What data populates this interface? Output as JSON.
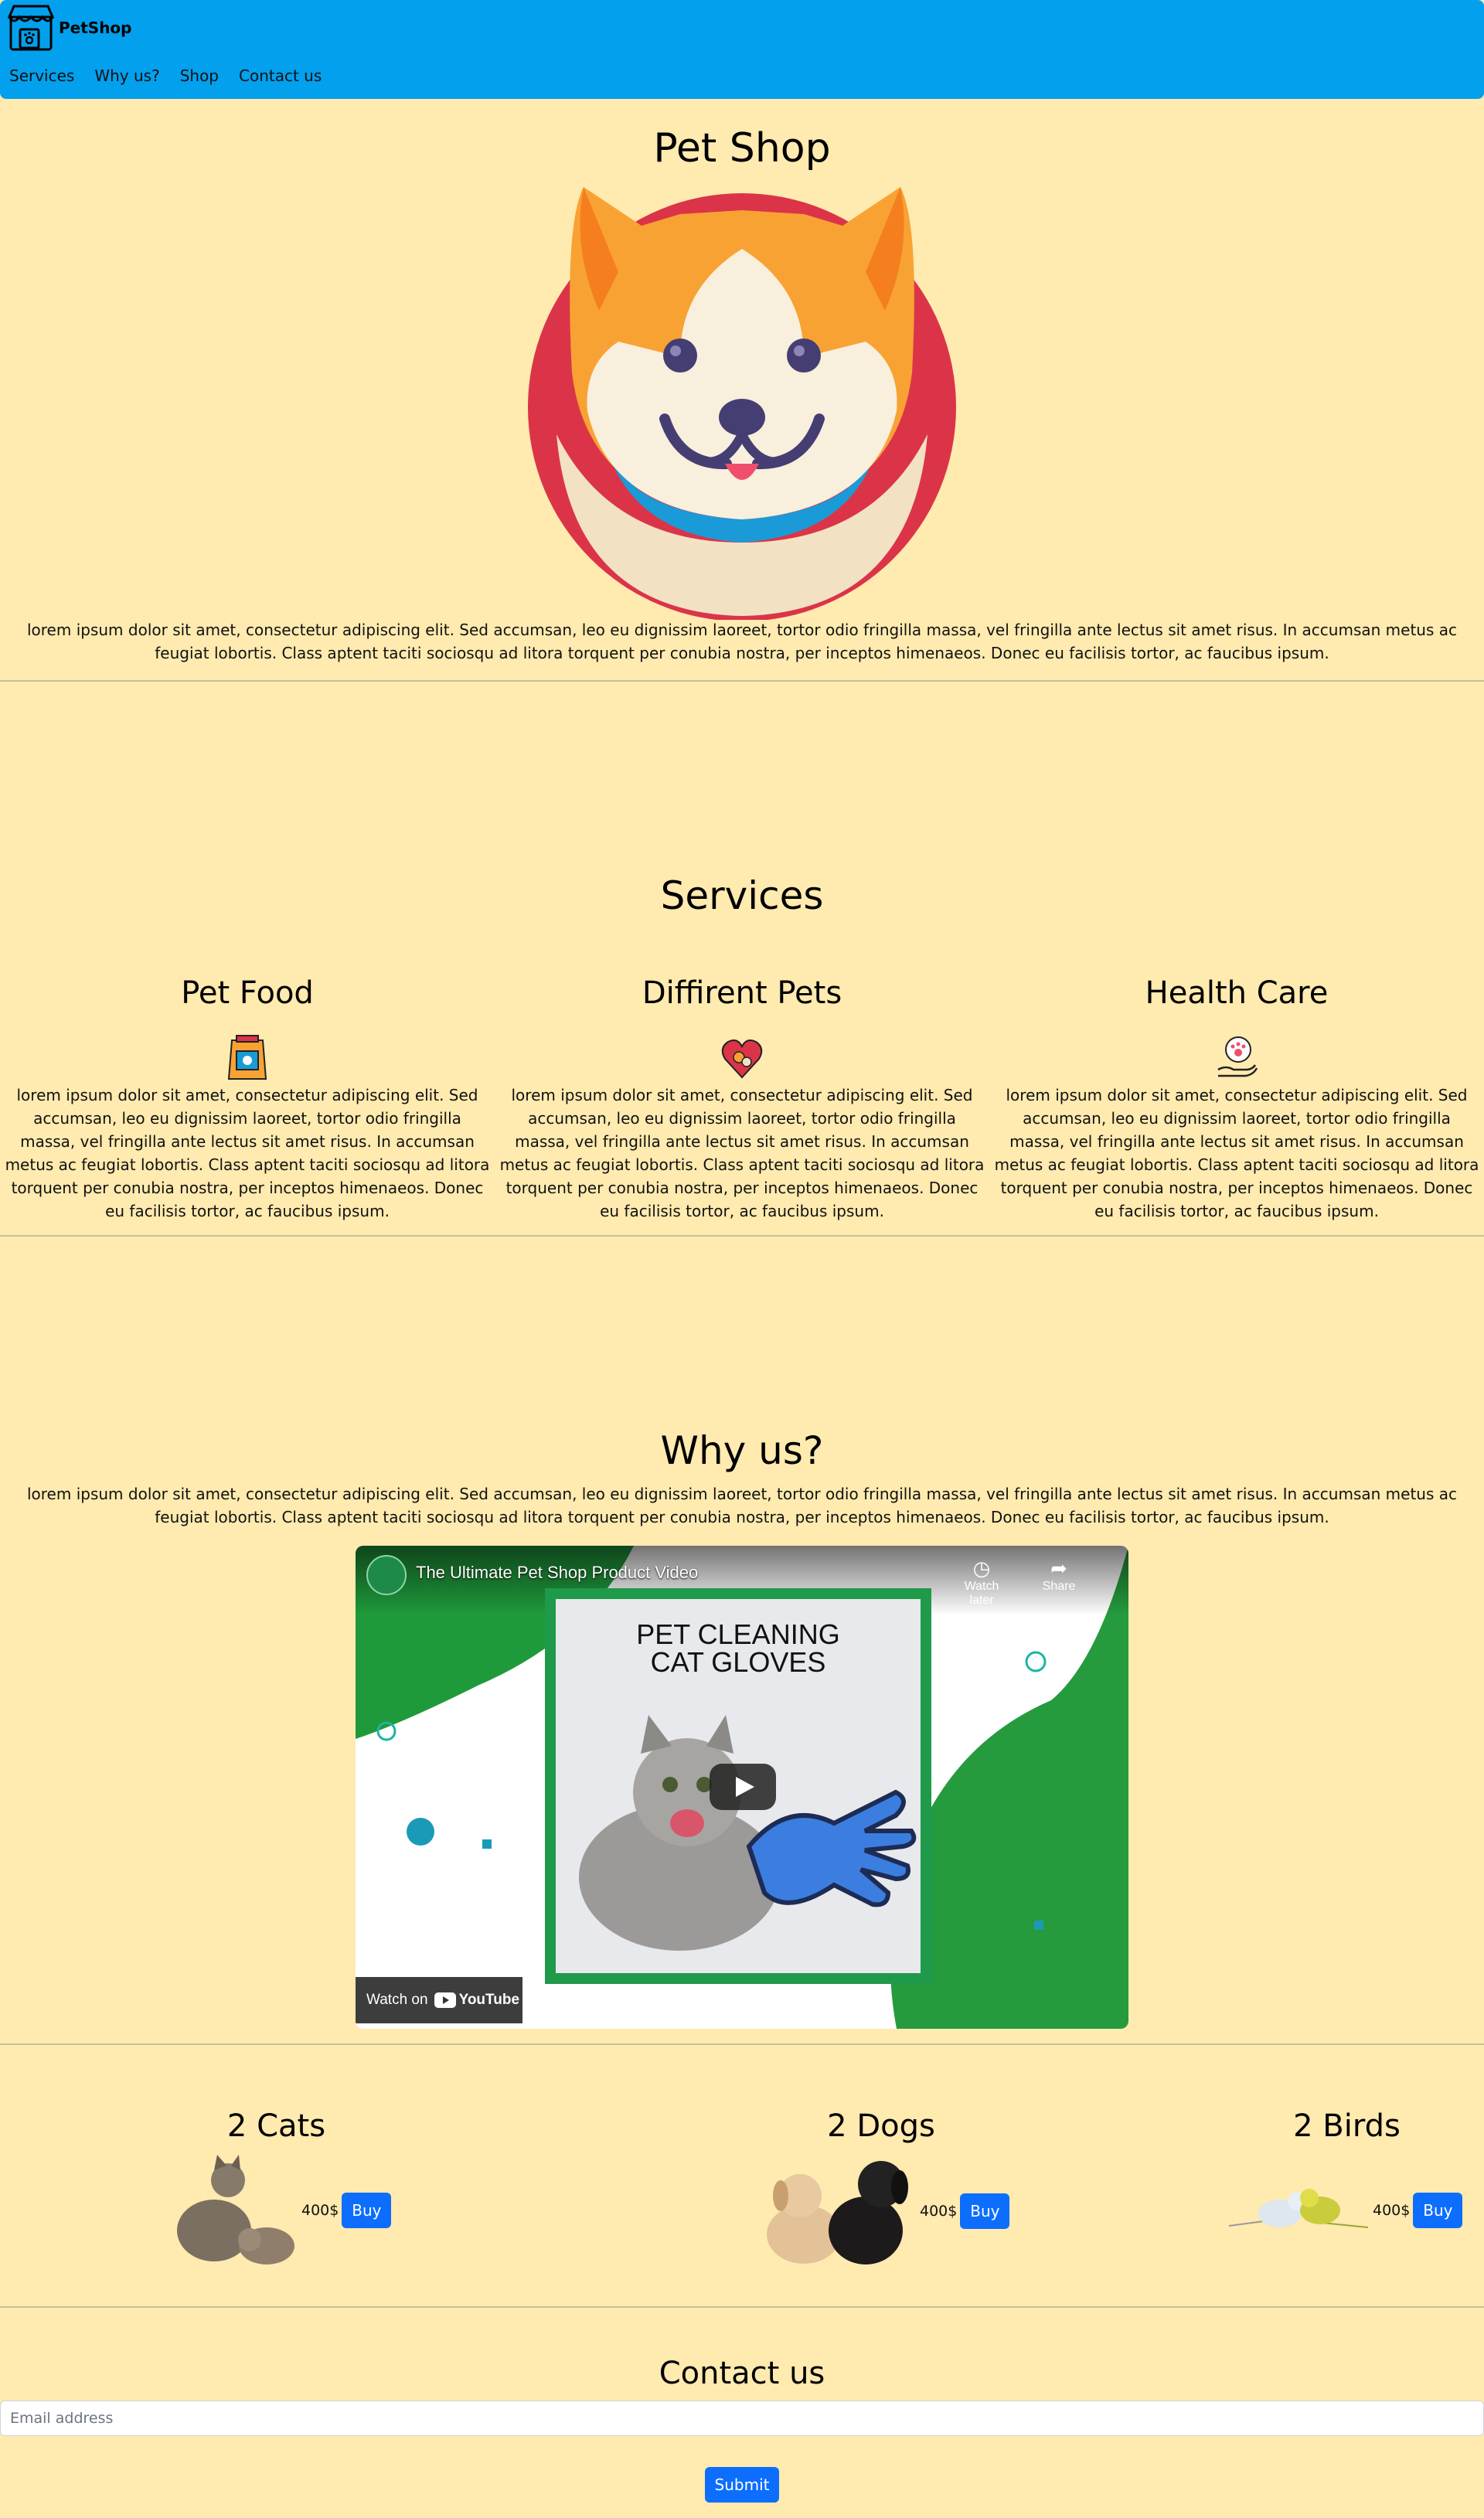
{
  "navbar": {
    "brand": "PetShop",
    "links": [
      "Services",
      "Why us?",
      "Shop",
      "Contact us"
    ]
  },
  "hero": {
    "title": "Pet Shop",
    "text": "lorem ipsum dolor sit amet, consectetur adipiscing elit. Sed accumsan, leo eu dignissim laoreet, tortor odio fringilla massa, vel fringilla ante lectus sit amet risus. In accumsan metus ac feugiat lobortis. Class aptent taciti sociosqu ad litora torquent per conubia nostra, per inceptos himenaeos. Donec eu facilisis tortor, ac faucibus ipsum."
  },
  "services": {
    "title": "Services",
    "items": [
      {
        "title": "Pet Food",
        "icon": "pet-food-bag-icon",
        "text": "lorem ipsum dolor sit amet, consectetur adipiscing elit. Sed accumsan, leo eu dignissim laoreet, tortor odio fringilla massa, vel fringilla ante lectus sit amet risus. In accumsan metus ac feugiat lobortis. Class aptent taciti sociosqu ad litora torquent per conubia nostra, per inceptos himenaeos. Donec eu facilisis tortor, ac faucibus ipsum."
      },
      {
        "title": "Diffirent Pets",
        "icon": "heart-pets-icon",
        "text": "lorem ipsum dolor sit amet, consectetur adipiscing elit. Sed accumsan, leo eu dignissim laoreet, tortor odio fringilla massa, vel fringilla ante lectus sit amet risus. In accumsan metus ac feugiat lobortis. Class aptent taciti sociosqu ad litora torquent per conubia nostra, per inceptos himenaeos. Donec eu facilisis tortor, ac faucibus ipsum."
      },
      {
        "title": "Health Care",
        "icon": "paw-care-hand-icon",
        "text": "lorem ipsum dolor sit amet, consectetur adipiscing elit. Sed accumsan, leo eu dignissim laoreet, tortor odio fringilla massa, vel fringilla ante lectus sit amet risus. In accumsan metus ac feugiat lobortis. Class aptent taciti sociosqu ad litora torquent per conubia nostra, per inceptos himenaeos. Donec eu facilisis tortor, ac faucibus ipsum."
      }
    ]
  },
  "why": {
    "title": "Why us?",
    "text": "lorem ipsum dolor sit amet, consectetur adipiscing elit. Sed accumsan, leo eu dignissim laoreet, tortor odio fringilla massa, vel fringilla ante lectus sit amet risus. In accumsan metus ac feugiat lobortis. Class aptent taciti sociosqu ad litora torquent per conubia nostra, per inceptos himenaeos. Donec eu facilisis tortor, ac faucibus ipsum.",
    "video": {
      "title": "The Ultimate Pet Shop Product Video",
      "watch_later": "Watch later",
      "share": "Share",
      "product_title_line1": "PET CLEANING",
      "product_title_line2": "CAT GLOVES",
      "watch_on": "Watch on",
      "youtube": "YouTube"
    }
  },
  "shop": {
    "items": [
      {
        "title": "2 Cats",
        "price": "400$",
        "buy": "Buy"
      },
      {
        "title": "2 Dogs",
        "price": "400$",
        "buy": "Buy"
      },
      {
        "title": "2 Birds",
        "price": "400$",
        "buy": "Buy"
      }
    ]
  },
  "contact": {
    "title": "Contact us",
    "email_placeholder": "Email address",
    "submit": "Submit"
  },
  "colors": {
    "background": "#ffeaaf",
    "navbar": "#03a0ee",
    "button": "#0d6efd"
  }
}
